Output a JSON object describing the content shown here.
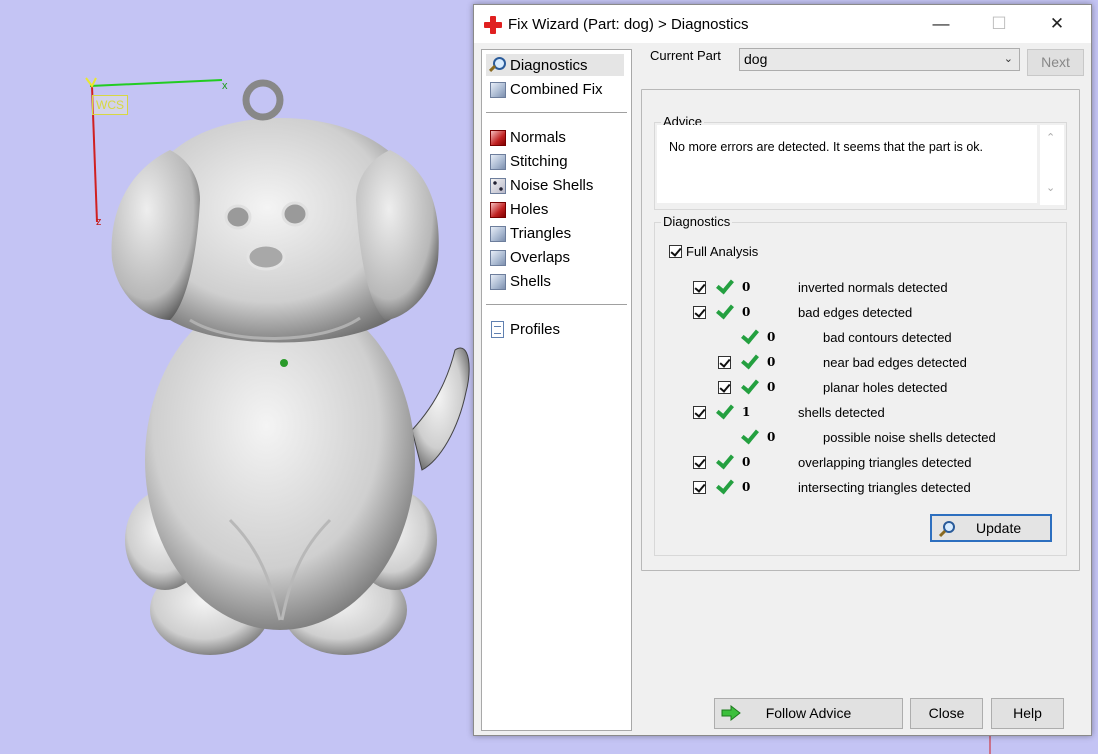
{
  "viewport": {
    "wcs_label": "WCS",
    "axis_x_label": "x",
    "axis_z_label": "z"
  },
  "dialog": {
    "title": "Fix Wizard (Part: dog) > Diagnostics",
    "window_controls": {
      "minimize": "—",
      "maximize": "☐",
      "close": "✕"
    }
  },
  "nav": {
    "group1": [
      {
        "label": "Diagnostics",
        "icon": "magnifier-icon",
        "selected": true
      },
      {
        "label": "Combined Fix",
        "icon": "cube-icon"
      }
    ],
    "group2": [
      {
        "label": "Normals",
        "icon": "red-cube-icon"
      },
      {
        "label": "Stitching",
        "icon": "cube-icon"
      },
      {
        "label": "Noise Shells",
        "icon": "dotted-cube-icon"
      },
      {
        "label": "Holes",
        "icon": "red-cube-icon"
      },
      {
        "label": "Triangles",
        "icon": "cube-icon"
      },
      {
        "label": "Overlaps",
        "icon": "cube-icon"
      },
      {
        "label": "Shells",
        "icon": "cube-icon"
      }
    ],
    "group3": [
      {
        "label": "Profiles",
        "icon": "document-icon"
      }
    ]
  },
  "header": {
    "current_part_label": "Current Part",
    "current_part_value": "dog",
    "next_label": "Next"
  },
  "advice": {
    "title": "Advice",
    "text": "No more errors are detected. It seems that the part is ok."
  },
  "diagnostics": {
    "title": "Diagnostics",
    "full_analysis_label": "Full Analysis",
    "rows": [
      {
        "count": "0",
        "text": "inverted normals detected",
        "checkbox": true,
        "indent": 0
      },
      {
        "count": "0",
        "text": "bad edges detected",
        "checkbox": true,
        "indent": 0
      },
      {
        "count": "0",
        "text": "bad contours detected",
        "checkbox": false,
        "indent": 1
      },
      {
        "count": "0",
        "text": "near bad edges detected",
        "checkbox": true,
        "indent": 1
      },
      {
        "count": "0",
        "text": "planar holes detected",
        "checkbox": true,
        "indent": 1
      },
      {
        "count": "1",
        "text": "shells detected",
        "checkbox": true,
        "indent": 0
      },
      {
        "count": "0",
        "text": "possible noise shells detected",
        "checkbox": false,
        "indent": 1
      },
      {
        "count": "0",
        "text": "overlapping triangles detected",
        "checkbox": true,
        "indent": 0
      },
      {
        "count": "0",
        "text": "intersecting triangles detected",
        "checkbox": true,
        "indent": 0
      }
    ],
    "update_label": "Update"
  },
  "footer": {
    "follow_advice_label": "Follow Advice",
    "close_label": "Close",
    "help_label": "Help"
  },
  "colors": {
    "viewport_bg": "#c4c4f4",
    "check_green": "#24a040",
    "focus_blue": "#2d6fbf"
  }
}
